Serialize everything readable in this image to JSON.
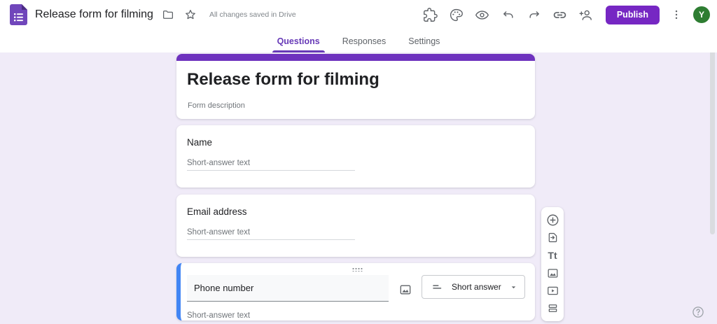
{
  "header": {
    "title": "Release form for filming",
    "saved_status": "All changes saved in Drive",
    "publish_label": "Publish",
    "avatar_initial": "Y",
    "action_icons": [
      "extensions",
      "customize-theme",
      "preview",
      "undo",
      "redo",
      "copy-link",
      "add-collaborators",
      "more-options"
    ]
  },
  "tabs": [
    {
      "label": "Questions",
      "active": true
    },
    {
      "label": "Responses",
      "active": false
    },
    {
      "label": "Settings",
      "active": false
    }
  ],
  "form": {
    "title": "Release form for filming",
    "description_placeholder": "Form description",
    "questions": [
      {
        "title": "Name",
        "answer_placeholder": "Short-answer text",
        "active": false
      },
      {
        "title": "Email address",
        "answer_placeholder": "Short-answer text",
        "active": false
      },
      {
        "title": "Phone number",
        "answer_placeholder": "Short-answer text",
        "active": true,
        "type_label": "Short answer"
      }
    ]
  },
  "side_toolbar": {
    "items": [
      "add-question",
      "import-questions",
      "add-title-description",
      "add-image",
      "add-video",
      "add-section"
    ],
    "text_icon_label": "Tt"
  },
  "colors": {
    "theme_purple": "#6e32be",
    "tab_purple": "#673ab7",
    "publish_purple": "#7627c3",
    "active_card_blue": "#4285f4",
    "page_background": "#f0ebf8",
    "avatar_green": "#2e7d32"
  }
}
